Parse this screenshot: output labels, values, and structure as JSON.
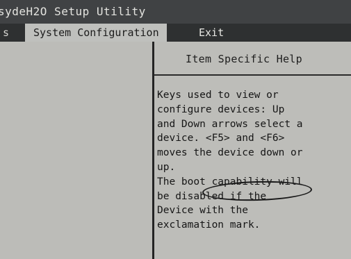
{
  "window": {
    "title": "sydeH2O Setup Utility"
  },
  "menu": {
    "items": [
      {
        "label": "s"
      },
      {
        "label": "System Configuration"
      },
      {
        "label": "Exit"
      }
    ]
  },
  "help": {
    "title": "Item Specific Help",
    "lines": [
      "Keys used to view or",
      "configure devices: Up",
      "and Down arrows select a",
      "device. <F5> and <F6>",
      "moves the device down or",
      "up.",
      "The boot capability will",
      "be disabled if the",
      "Device with the",
      "exclamation mark."
    ]
  },
  "colors": {
    "titlebar": "#404244",
    "menubar": "#2e3031",
    "active_tab": "#bfc0bd",
    "panel": "#bdbdb9"
  }
}
